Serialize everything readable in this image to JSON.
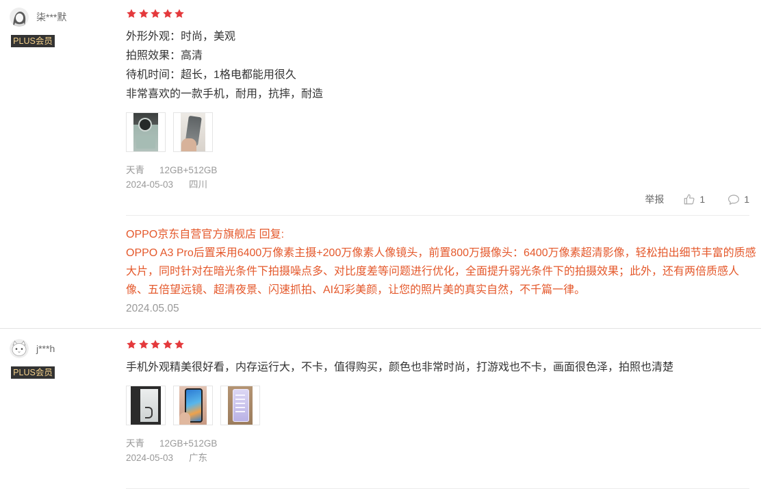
{
  "colors": {
    "star": "#e4393c",
    "reply": "#e4582b",
    "badge-bg": "#333333",
    "badge-text": "#f3d08a"
  },
  "icons": {
    "rating": "star-icon",
    "like": "thumb-up-icon",
    "comment": "comment-icon"
  },
  "reviews": [
    {
      "user": {
        "name": "柒***默",
        "badge": "PLUS会员"
      },
      "rating": 5,
      "content_lines": [
        "外形外观：时尚，美观",
        "拍照效果：高清",
        "待机时间：超长，1格电都能用很久",
        "非常喜欢的一款手机，耐用，抗摔，耐造"
      ],
      "product": {
        "color": "天青",
        "spec": "12GB+512GB"
      },
      "date": "2024-05-03",
      "location": "四川",
      "actions": {
        "report_label": "举报",
        "like_count": "1",
        "comment_count": "1"
      },
      "reply": {
        "header": "OPPO京东自营官方旗舰店 回复:",
        "text": "OPPO A3 Pro后置采用6400万像素主摄+200万像素人像镜头，前置800万摄像头：6400万像素超清影像，轻松拍出细节丰富的质感大片，同时针对在暗光条件下拍摄噪点多、对比度差等问题进行优化，全面提升弱光条件下的拍摄效果；此外，还有两倍质感人像、五倍望远镜、超清夜景、闪速抓拍、AI幻彩美颜，让您的照片美的真实自然，不千篇一律。",
        "date": "2024.05.05"
      }
    },
    {
      "user": {
        "name": "j***h",
        "badge": "PLUS会员"
      },
      "rating": 5,
      "content_lines": [
        "手机外观精美很好看，内存运行大，不卡，值得购买，颜色也非常时尚，打游戏也不卡，画面很色泽，拍照也清楚"
      ],
      "product": {
        "color": "天青",
        "spec": "12GB+512GB"
      },
      "date": "2024-05-03",
      "location": "广东"
    }
  ]
}
